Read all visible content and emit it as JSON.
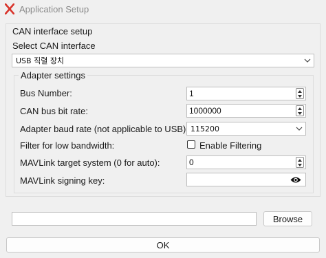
{
  "window": {
    "title": "Application Setup",
    "app_icon": "x-logo-icon"
  },
  "can_setup": {
    "section_title": "CAN interface setup",
    "select_label": "Select CAN interface",
    "interface_value": "USB 직렬 장치"
  },
  "adapter": {
    "group_title": "Adapter settings",
    "bus_number_label": "Bus Number:",
    "bus_number_value": "1",
    "bitrate_label": "CAN bus bit rate:",
    "bitrate_value": "1000000",
    "baud_label": "Adapter baud rate (not applicable to USB):",
    "baud_value": "115200",
    "filter_label": "Filter for low bandwidth:",
    "filter_checkbox_label": "Enable Filtering",
    "filter_checked": false,
    "mav_target_label": "MAVLink target system (0 for auto):",
    "mav_target_value": "0",
    "signing_key_label": "MAVLink signing key:",
    "signing_key_value": "",
    "signing_key_icon": "eye-icon"
  },
  "file": {
    "path_value": "",
    "browse_label": "Browse"
  },
  "ok_label": "OK"
}
